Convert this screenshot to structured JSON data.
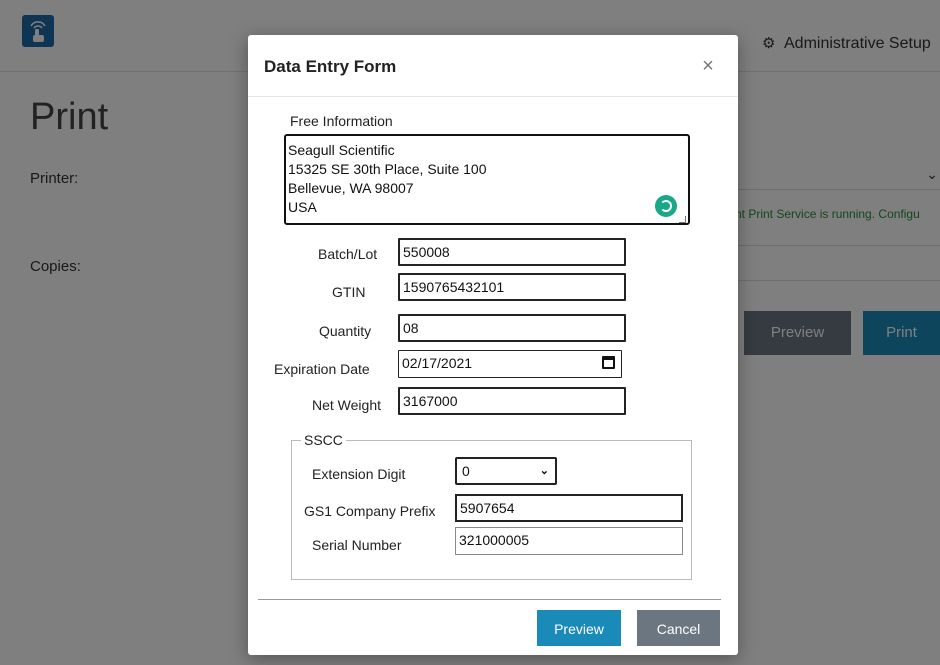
{
  "background": {
    "admin_link": "Administrative Setup",
    "page_title": "Print",
    "printer_label": "Printer:",
    "copies_label": "Copies:",
    "service_status": "nt Print Service is running.  Configu",
    "preview_button": "Preview",
    "print_button": "Print"
  },
  "modal": {
    "title": "Data Entry Form",
    "close_glyph": "×",
    "free_information": {
      "label": "Free Information",
      "lines": [
        "Seagull Scientific",
        "15325 SE 30th Place, Suite 100",
        "Bellevue, WA 98007",
        "USA"
      ]
    },
    "fields": {
      "batch_lot": {
        "label": "Batch/Lot",
        "value": "550008"
      },
      "gtin": {
        "label": "GTIN",
        "value": "1590765432101"
      },
      "quantity": {
        "label": "Quantity",
        "value": "08"
      },
      "expiration_date": {
        "label": "Expiration Date",
        "value": "02/17/2021"
      },
      "net_weight": {
        "label": "Net Weight",
        "value": "3167000"
      }
    },
    "sscc": {
      "legend": "SSCC",
      "extension_digit": {
        "label": "Extension Digit",
        "value": "0"
      },
      "gs1_company_prefix": {
        "label": "GS1 Company Prefix",
        "value": "5907654"
      },
      "serial_number": {
        "label": "Serial Number",
        "value": "321000005"
      }
    },
    "footer": {
      "preview_button": "Preview",
      "cancel_button": "Cancel"
    }
  },
  "colors": {
    "accent": "#1a8ab8",
    "secondary_button": "#6b7680",
    "status_text": "#2c8a3c",
    "spinner": "#1aa88a"
  }
}
